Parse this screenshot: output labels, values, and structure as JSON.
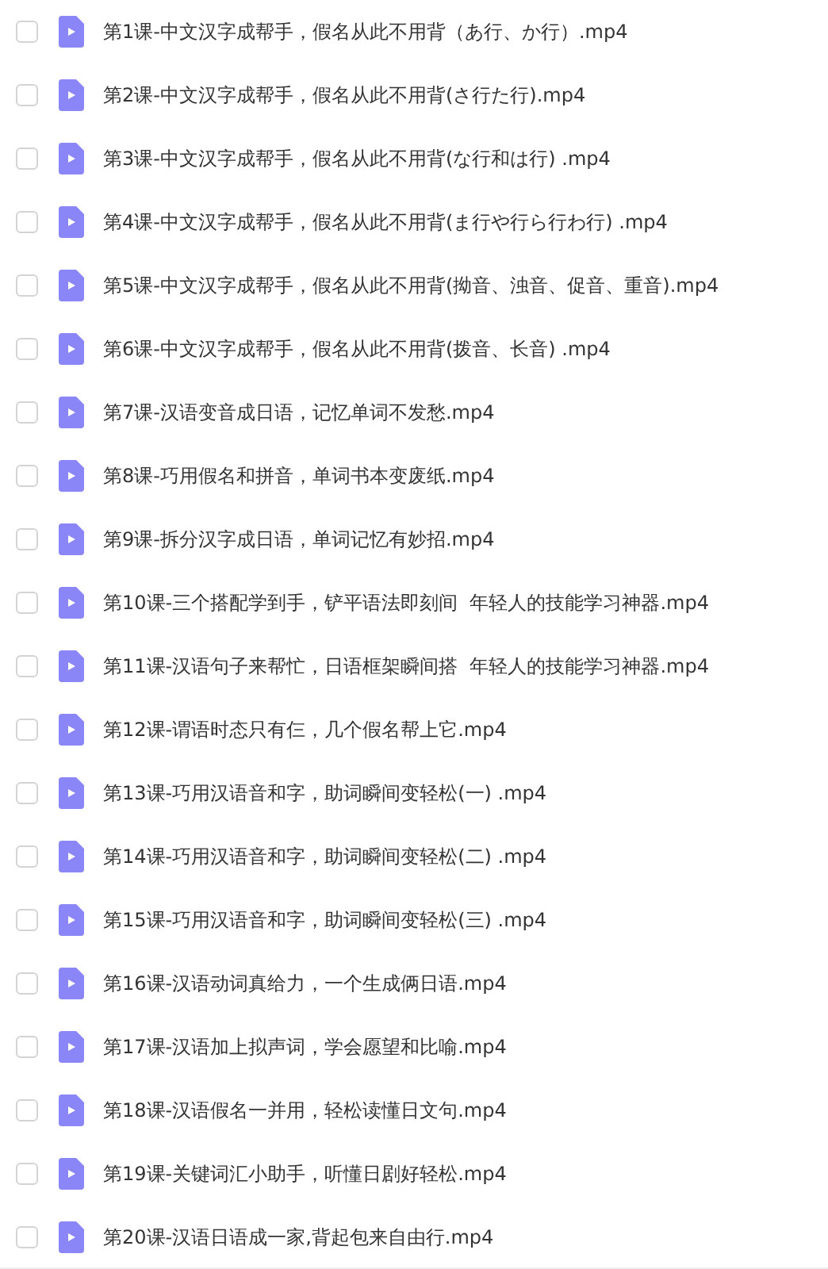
{
  "files": [
    {
      "name": "第1课-中文汉字成帮手，假名从此不用背（あ行、か行）.mp4",
      "checked": false
    },
    {
      "name": "第2课-中文汉字成帮手，假名从此不用背(さ行た行).mp4",
      "checked": false
    },
    {
      "name": "第3课-中文汉字成帮手，假名从此不用背(な行和は行) .mp4",
      "checked": false
    },
    {
      "name": "第4课-中文汉字成帮手，假名从此不用背(ま行や行ら行わ行) .mp4",
      "checked": false
    },
    {
      "name": "第5课-中文汉字成帮手，假名从此不用背(拗音、浊音、促音、重音).mp4",
      "checked": false
    },
    {
      "name": "第6课-中文汉字成帮手，假名从此不用背(拨音、长音) .mp4",
      "checked": false
    },
    {
      "name": "第7课-汉语变音成日语，记忆单词不发愁.mp4",
      "checked": false
    },
    {
      "name": "第8课-巧用假名和拼音，单词书本变废纸.mp4",
      "checked": false
    },
    {
      "name": "第9课-拆分汉字成日语，单词记忆有妙招.mp4",
      "checked": false
    },
    {
      "name": "第10课-三个搭配学到手，铲平语法即刻间  年轻人的技能学习神器.mp4",
      "checked": false
    },
    {
      "name": "第11课-汉语句子来帮忙，日语框架瞬间搭  年轻人的技能学习神器.mp4",
      "checked": false
    },
    {
      "name": "第12课-谓语时态只有仨，几个假名帮上它.mp4",
      "checked": false
    },
    {
      "name": "第13课-巧用汉语音和字，助词瞬间变轻松(一) .mp4",
      "checked": false
    },
    {
      "name": "第14课-巧用汉语音和字，助词瞬间变轻松(二) .mp4",
      "checked": false
    },
    {
      "name": "第15课-巧用汉语音和字，助词瞬间变轻松(三) .mp4",
      "checked": false
    },
    {
      "name": "第16课-汉语动词真给力，一个生成俩日语.mp4",
      "checked": false
    },
    {
      "name": "第17课-汉语加上拟声词，学会愿望和比喻.mp4",
      "checked": false
    },
    {
      "name": "第18课-汉语假名一并用，轻松读懂日文句.mp4",
      "checked": false
    },
    {
      "name": "第19课-关键词汇小助手，听懂日剧好轻松.mp4",
      "checked": false
    },
    {
      "name": "第20课-汉语日语成一家,背起包来自由行.mp4",
      "checked": false
    }
  ]
}
